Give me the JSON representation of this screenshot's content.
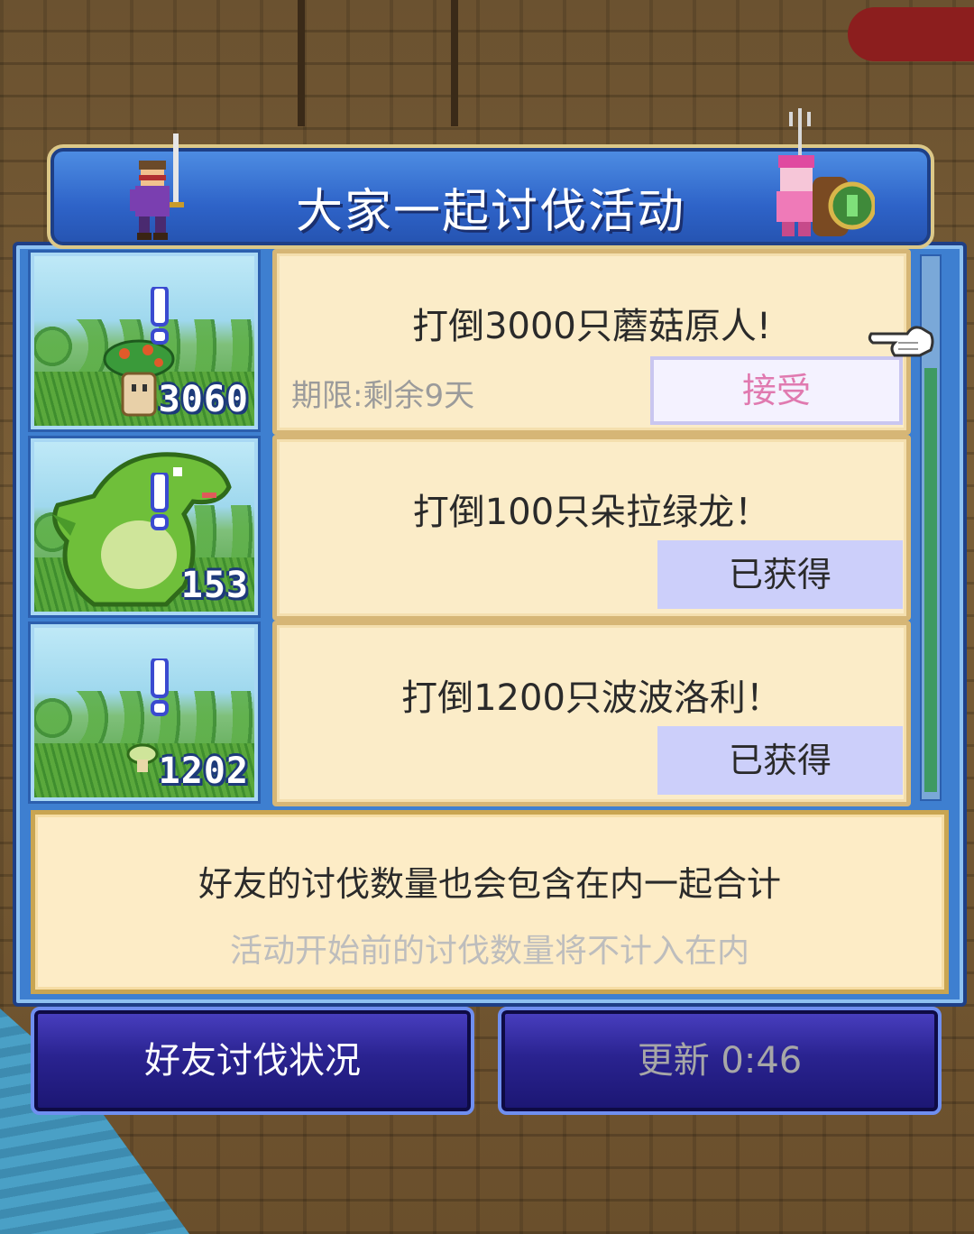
{
  "dialog": {
    "title": "大家一起讨伐活动"
  },
  "quests": [
    {
      "monster": "mushroom",
      "count": "3060",
      "title": "打倒3000只蘑菇原人!",
      "deadline": "期限:剩余9天",
      "status": "接受",
      "status_type": "accept"
    },
    {
      "monster": "green-dragon",
      "count": "153",
      "title": "打倒100只朵拉绿龙！",
      "deadline": "",
      "status": "已获得",
      "status_type": "obtained"
    },
    {
      "monster": "poporie",
      "count": "1202",
      "title": "打倒1200只波波洛利！",
      "deadline": "",
      "status": "已获得",
      "status_type": "obtained"
    }
  ],
  "info": {
    "line1": "好友的讨伐数量也会包含在内一起合计",
    "line2": "活动开始前的讨伐数量将不计入在内"
  },
  "buttons": {
    "friends_status": "好友讨伐状况",
    "refresh": "更新 0:46"
  },
  "colors": {
    "panel": "#3e7fd0",
    "card": "#fbecc8",
    "accept_text": "#e07ab0",
    "obtained_bg": "#cccffa"
  }
}
